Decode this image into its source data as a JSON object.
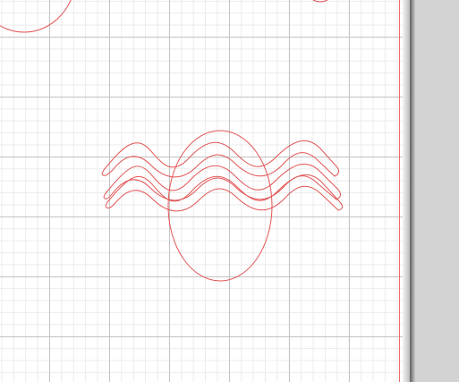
{
  "app": {
    "accent_color": "#e25555",
    "grid_major_color": "#c4c4c4",
    "grid_minor_color": "#ececec",
    "panel_color": "#d3d3d3"
  }
}
